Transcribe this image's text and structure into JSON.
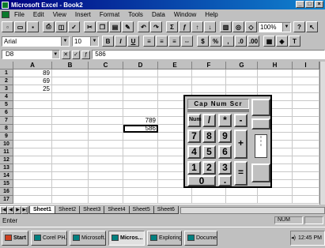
{
  "window": {
    "title": "Microsoft Excel - Book2"
  },
  "menu": [
    "File",
    "Edit",
    "View",
    "Insert",
    "Format",
    "Tools",
    "Data",
    "Window",
    "Help"
  ],
  "toolbar": {
    "zoom": "100%"
  },
  "format_toolbar": {
    "font": "Arial",
    "size": "10"
  },
  "formula_bar": {
    "name_box": "D8",
    "content": "586"
  },
  "columns": [
    "A",
    "B",
    "C",
    "D",
    "E",
    "F",
    "G",
    "H",
    "I"
  ],
  "rows": [
    {
      "n": "1",
      "cells": {
        "A": "89"
      }
    },
    {
      "n": "2",
      "cells": {
        "A": "69"
      }
    },
    {
      "n": "3",
      "cells": {
        "A": "25"
      }
    },
    {
      "n": "4",
      "cells": {}
    },
    {
      "n": "5",
      "cells": {}
    },
    {
      "n": "6",
      "cells": {}
    },
    {
      "n": "7",
      "cells": {
        "D": "789"
      }
    },
    {
      "n": "8",
      "cells": {
        "D": "586"
      }
    },
    {
      "n": "9",
      "cells": {}
    },
    {
      "n": "10",
      "cells": {}
    },
    {
      "n": "11",
      "cells": {}
    },
    {
      "n": "12",
      "cells": {}
    },
    {
      "n": "13",
      "cells": {}
    },
    {
      "n": "14",
      "cells": {}
    },
    {
      "n": "15",
      "cells": {}
    },
    {
      "n": "16",
      "cells": {}
    },
    {
      "n": "17",
      "cells": {}
    }
  ],
  "active_cell": "D8",
  "sheet_tabs": [
    "Sheet1",
    "Sheet2",
    "Sheet3",
    "Sheet4",
    "Sheet5",
    "Sheet6"
  ],
  "active_sheet": "Sheet1",
  "status": {
    "text": "Enter",
    "num": "NUM"
  },
  "calculator": {
    "mode": "Cap  Num  Scr",
    "keys": {
      "num": "Num",
      "div": "/",
      "mul": "*",
      "sub": "-",
      "k7": "7",
      "k8": "8",
      "k9": "9",
      "add": "+",
      "k4": "4",
      "k5": "5",
      "k6": "6",
      "k1": "1",
      "k2": "2",
      "k3": "3",
      "eq": "=",
      "k0": "0",
      "dot": "."
    }
  },
  "taskbar": {
    "start": "Start",
    "items": [
      "Corel PH...",
      "Microsoft...",
      "Micros...",
      "Exploring...",
      "Docume..."
    ],
    "active_index": 2,
    "clock": "12:45 PM"
  }
}
